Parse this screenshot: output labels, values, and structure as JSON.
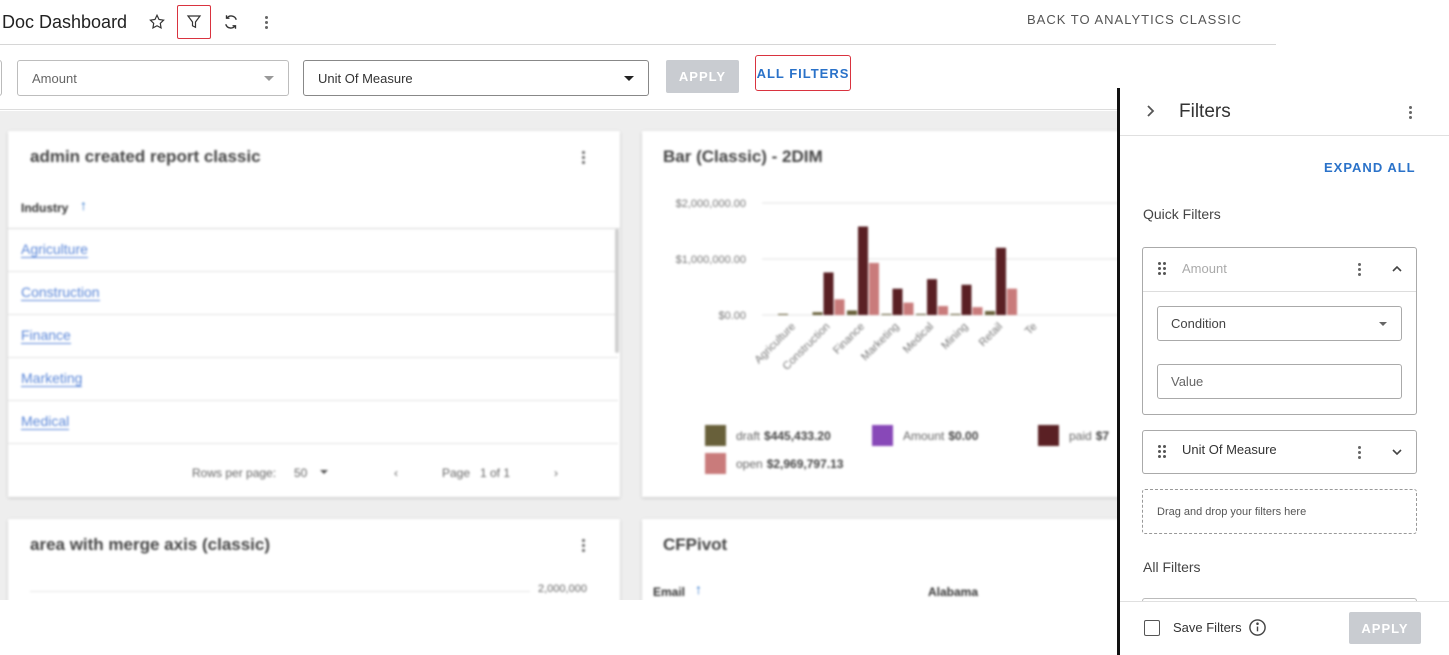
{
  "header": {
    "title": "Doc Dashboard",
    "back_link": "BACK TO ANALYTICS CLASSIC",
    "icons": [
      "star-icon",
      "filter-icon",
      "refresh-icon",
      "kebab-menu-icon"
    ]
  },
  "filterbar": {
    "amount_placeholder": "Amount",
    "uom_value": "Unit Of Measure",
    "apply_label": "APPLY",
    "all_filters_label": "ALL FILTERS"
  },
  "cards": {
    "report": {
      "title": "admin created report classic",
      "column_header": "Industry",
      "rows": [
        "Agriculture",
        "Construction",
        "Finance",
        "Marketing",
        "Medical"
      ],
      "rows_per_page_label": "Rows per page:",
      "rows_per_page_value": "50",
      "page_label": "Page",
      "page_value": "1 of 1"
    },
    "bar": {
      "title": "Bar (Classic) - 2DIM",
      "legend": [
        {
          "label": "draft",
          "value": "$445,433.20",
          "color": "#68603a"
        },
        {
          "label": "Amount",
          "value": "$0.00",
          "color": "#8848b8"
        },
        {
          "label": "paid",
          "value": "$7",
          "color": "#5a2024"
        },
        {
          "label": "open",
          "value": "$2,969,797.13",
          "color": "#c97b7b"
        }
      ]
    },
    "area": {
      "title": "area with merge axis (classic)",
      "axis_tick": "2,000,000"
    },
    "pivot": {
      "title": "CFPivot",
      "col1": "Email",
      "col2": "Alabama"
    }
  },
  "chart_data": {
    "type": "bar",
    "categories": [
      "Agriculture",
      "Construction",
      "Finance",
      "Marketing",
      "Medical",
      "Mining",
      "Retail",
      "Te"
    ],
    "series": [
      {
        "name": "draft",
        "color": "#68603a",
        "values": [
          20000,
          50000,
          80000,
          20000,
          20000,
          20000,
          70000,
          0
        ]
      },
      {
        "name": "paid",
        "color": "#5a2024",
        "values": [
          0,
          760000,
          1580000,
          470000,
          640000,
          540000,
          1200000,
          0
        ]
      },
      {
        "name": "open",
        "color": "#c97b7b",
        "values": [
          0,
          280000,
          930000,
          220000,
          160000,
          140000,
          470000,
          0
        ]
      },
      {
        "name": "Amount",
        "color": "#8848b8",
        "values": [
          0,
          0,
          0,
          0,
          0,
          0,
          0,
          0
        ]
      }
    ],
    "yticks": [
      "$0.00",
      "$1,000,000.00",
      "$2,000,000.00"
    ],
    "ylim": [
      0,
      2000000
    ],
    "grid": true,
    "legend_position": "bottom"
  },
  "panel": {
    "title": "Filters",
    "expand_all": "EXPAND ALL",
    "quick_filters_label": "Quick Filters",
    "amount_filter": {
      "label": "Amount",
      "condition_placeholder": "Condition",
      "value_placeholder": "Value"
    },
    "uom_filter": {
      "label": "Unit Of Measure"
    },
    "drop_zone": "Drag and drop your filters here",
    "all_filters_label": "All Filters",
    "save_filters_label": "Save Filters",
    "apply_label": "APPLY"
  }
}
